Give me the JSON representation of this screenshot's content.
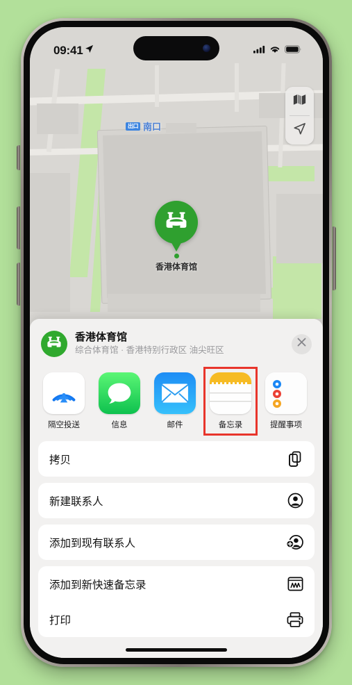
{
  "status_bar": {
    "time": "09:41",
    "location_arrow_icon": "location-arrow-icon",
    "cellular_icon": "cellular-bars-icon",
    "wifi_icon": "wifi-icon",
    "battery_icon": "battery-full-icon"
  },
  "map": {
    "transit_badge": "出口",
    "transit_label": "南口",
    "pin_label": "香港体育馆",
    "pin_icon": "stadium-icon",
    "pin_color": "#2fa02f",
    "controls": [
      {
        "name": "map-layers-button",
        "icon": "map-layers-icon"
      },
      {
        "name": "current-location-button",
        "icon": "location-arrow-icon"
      }
    ]
  },
  "share_sheet": {
    "place_icon": "stadium-icon",
    "title": "香港体育馆",
    "subtitle": "综合体育馆 · 香港特别行政区 油尖旺区",
    "close_label": "✕",
    "apps": [
      {
        "label": "隔空投送",
        "icon": "airdrop-icon",
        "highlighted": false
      },
      {
        "label": "信息",
        "icon": "messages-icon",
        "highlighted": false
      },
      {
        "label": "邮件",
        "icon": "mail-icon",
        "highlighted": false
      },
      {
        "label": "备忘录",
        "icon": "notes-icon",
        "highlighted": true
      },
      {
        "label": "提醒事项",
        "icon": "reminders-icon",
        "highlighted": false
      }
    ],
    "highlight_color": "#e8352b",
    "actions": [
      {
        "label": "拷贝",
        "icon": "copy-icon"
      },
      {
        "label": "新建联系人",
        "icon": "person-circle-icon"
      },
      {
        "label": "添加到现有联系人",
        "icon": "person-badge-plus-icon"
      },
      {
        "label": "添加到新快速备忘录",
        "icon": "quick-note-icon"
      },
      {
        "label": "打印",
        "icon": "printer-icon"
      }
    ]
  },
  "device": {
    "side_buttons": [
      "action-button",
      "volume-up-button",
      "volume-down-button",
      "power-button"
    ],
    "home_indicator": "home-indicator"
  }
}
